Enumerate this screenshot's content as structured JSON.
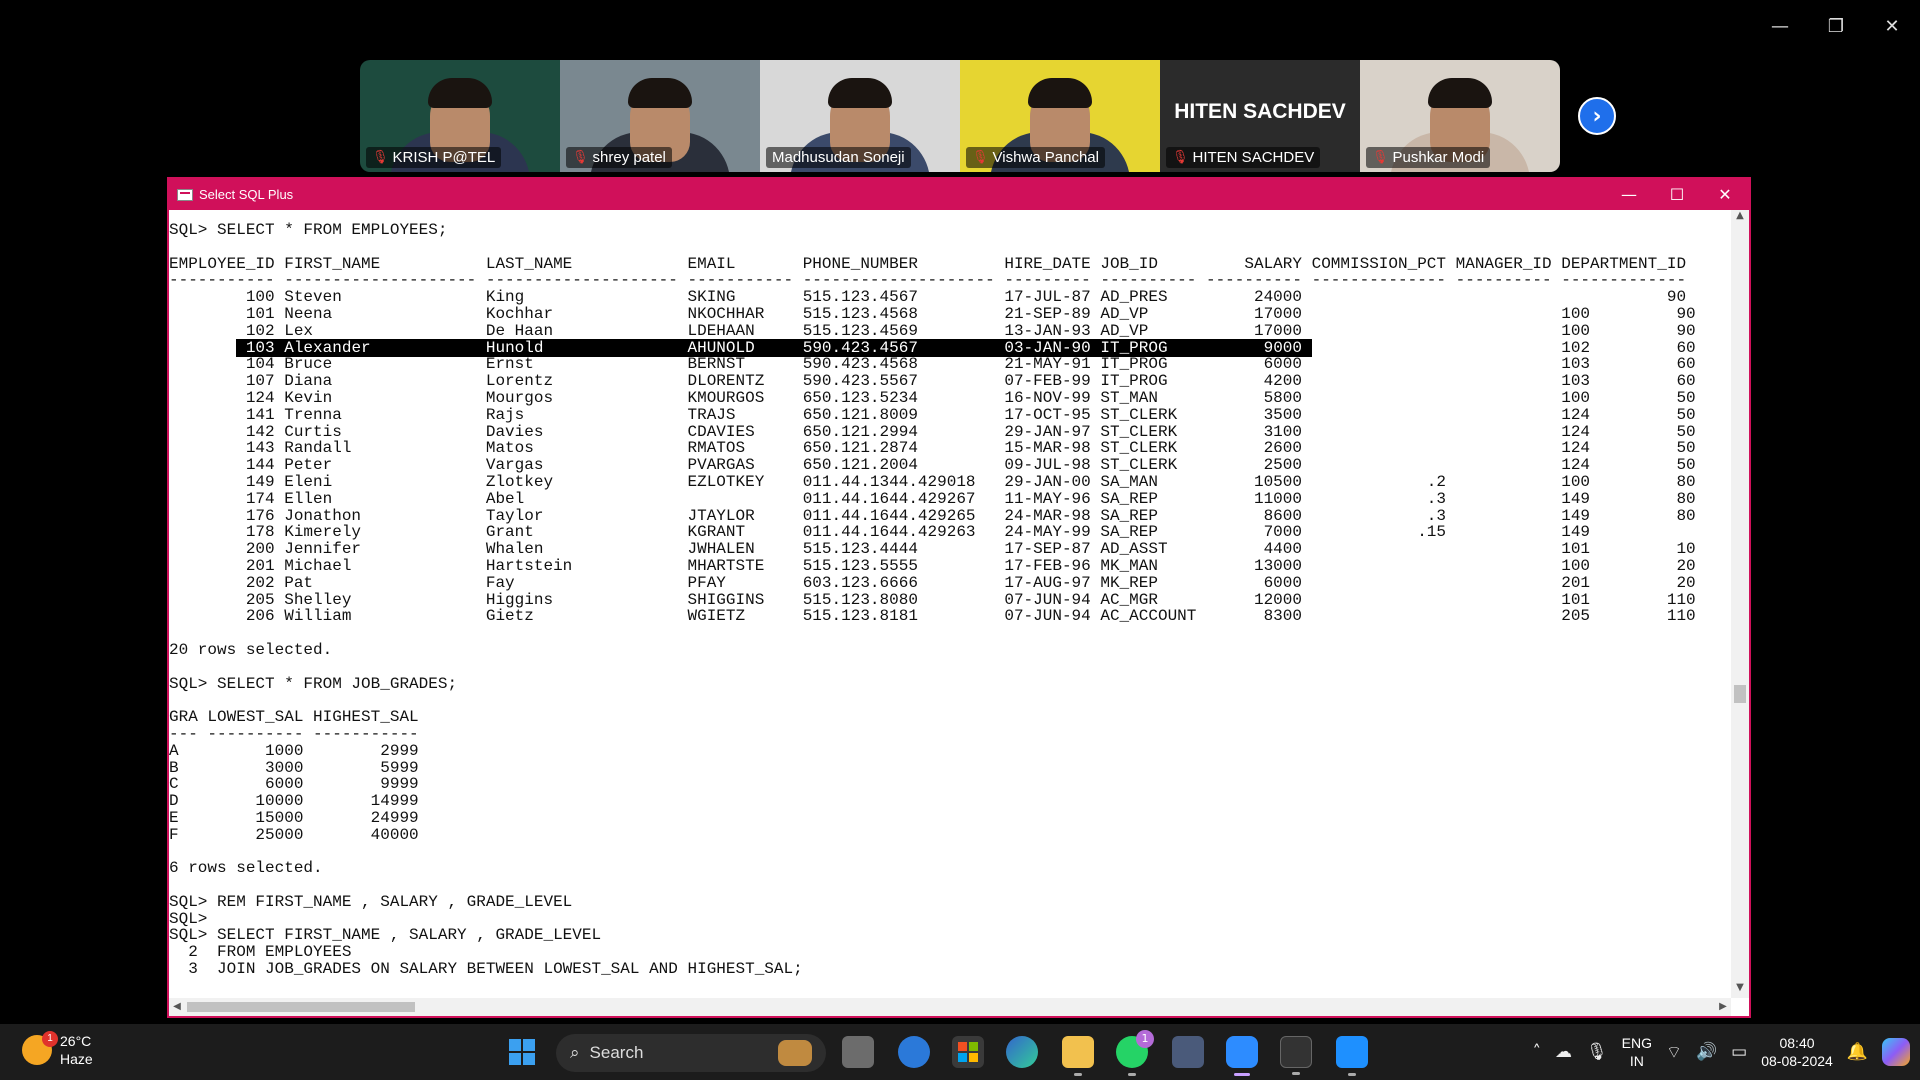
{
  "zoom_window": {
    "controls": {
      "minimize": "—",
      "restore": "❐",
      "close": "✕"
    }
  },
  "participants": [
    {
      "name": "KRISH P@TEL",
      "muted": true,
      "bg": "#1d4b3e",
      "shirt": "#2c3550"
    },
    {
      "name": "shrey patel",
      "muted": true,
      "bg": "#7a8890",
      "shirt": "#2a2f3a"
    },
    {
      "name": "Madhusudan Soneji",
      "muted": false,
      "bg": "#d8d8d8",
      "shirt": "#3b4a6a",
      "active": true
    },
    {
      "name": "Vishwa Panchal",
      "muted": true,
      "bg": "#e6d531",
      "shirt": "#2e3a4d"
    },
    {
      "name": "HITEN SACHDEV",
      "muted": true,
      "bg": "#2b2b2b",
      "video_off": true
    },
    {
      "name": "Pushkar Modi",
      "muted": true,
      "bg": "#d9d2c9",
      "shirt": "#c9b7a8"
    }
  ],
  "next_button": "›",
  "sql_window": {
    "title": "Select SQL Plus",
    "controls": {
      "minimize": "—",
      "maximize": "☐",
      "close": "✕"
    },
    "lines_before": [
      "SQL> SELECT * FROM EMPLOYEES;",
      "",
      "EMPLOYEE_ID FIRST_NAME           LAST_NAME            EMAIL       PHONE_NUMBER         HIRE_DATE JOB_ID         SALARY COMMISSION_PCT MANAGER_ID DEPARTMENT_ID",
      "----------- -------------------- -------------------- ----------- -------------------- --------- ---------- ---------- -------------- ---------- -------------",
      "        100 Steven               King                 SKING       515.123.4567         17-JUL-87 AD_PRES         24000                                      90",
      "        101 Neena                Kochhar              NKOCHHAR    515.123.4568         21-SEP-89 AD_VP           17000                           100         90",
      "        102 Lex                  De Haan              LDEHAAN     515.123.4569         13-JAN-93 AD_VP           17000                           100         90"
    ],
    "line_highlight_pre": "       ",
    "line_highlight": " 103 Alexander            Hunold               AHUNOLD     590.423.4567         03-JAN-90 IT_PROG          9000 ",
    "line_highlight_post": "                          102         60",
    "lines_after": [
      "        104 Bruce                Ernst                BERNST      590.423.4568         21-MAY-91 IT_PROG          6000                           103         60",
      "        107 Diana                Lorentz              DLORENTZ    590.423.5567         07-FEB-99 IT_PROG          4200                           103         60",
      "        124 Kevin                Mourgos              KMOURGOS    650.123.5234         16-NOV-99 ST_MAN           5800                           100         50",
      "        141 Trenna               Rajs                 TRAJS       650.121.8009         17-OCT-95 ST_CLERK         3500                           124         50",
      "        142 Curtis               Davies               CDAVIES     650.121.2994         29-JAN-97 ST_CLERK         3100                           124         50",
      "        143 Randall              Matos                RMATOS      650.121.2874         15-MAR-98 ST_CLERK         2600                           124         50",
      "        144 Peter                Vargas               PVARGAS     650.121.2004         09-JUL-98 ST_CLERK         2500                           124         50",
      "        149 Eleni                Zlotkey              EZLOTKEY    011.44.1344.429018   29-JAN-00 SA_MAN          10500             .2            100         80",
      "        174 Ellen                Abel                             011.44.1644.429267   11-MAY-96 SA_REP          11000             .3            149         80",
      "        176 Jonathon             Taylor               JTAYLOR     011.44.1644.429265   24-MAR-98 SA_REP           8600             .3            149         80",
      "        178 Kimerely             Grant                KGRANT      011.44.1644.429263   24-MAY-99 SA_REP           7000            .15            149",
      "        200 Jennifer             Whalen               JWHALEN     515.123.4444         17-SEP-87 AD_ASST          4400                           101         10",
      "        201 Michael              Hartstein            MHARTSTE    515.123.5555         17-FEB-96 MK_MAN          13000                           100         20",
      "        202 Pat                  Fay                  PFAY        603.123.6666         17-AUG-97 MK_REP           6000                           201         20",
      "        205 Shelley              Higgins              SHIGGINS    515.123.8080         07-JUN-94 AC_MGR          12000                           101        110",
      "        206 William              Gietz                WGIETZ      515.123.8181         07-JUN-94 AC_ACCOUNT       8300                           205        110",
      "",
      "20 rows selected.",
      "",
      "SQL> SELECT * FROM JOB_GRADES;",
      "",
      "GRA LOWEST_SAL HIGHEST_SAL",
      "--- ---------- -----------",
      "A         1000        2999",
      "B         3000        5999",
      "C         6000        9999",
      "D        10000       14999",
      "E        15000       24999",
      "F        25000       40000",
      "",
      "6 rows selected.",
      "",
      "SQL> REM FIRST_NAME , SALARY , GRADE_LEVEL",
      "SQL>",
      "SQL> SELECT FIRST_NAME , SALARY , GRADE_LEVEL",
      "  2  FROM EMPLOYEES",
      "  3  JOIN JOB_GRADES ON SALARY BETWEEN LOWEST_SAL AND HIGHEST_SAL;"
    ]
  },
  "taskbar": {
    "weather": {
      "temp": "26°C",
      "condition": "Haze",
      "badge": "1"
    },
    "search_placeholder": "Search",
    "whatsapp_badge": "1",
    "tray": {
      "lang_top": "ENG",
      "lang_bottom": "IN",
      "time": "08:40",
      "date": "08-08-2024"
    }
  }
}
